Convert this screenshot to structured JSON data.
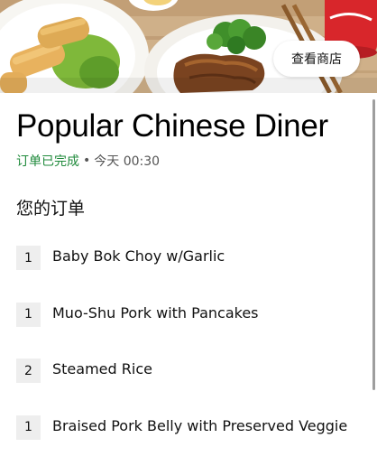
{
  "hero": {
    "image_icon": "food-photo",
    "store_button_label": "查看商店"
  },
  "store": {
    "name": "Popular Chinese Diner",
    "status": "订单已完成",
    "separator": "•",
    "time": "今天 00:30"
  },
  "order": {
    "title": "您的订单",
    "items": [
      {
        "qty": "1",
        "name": "Baby Bok Choy w/Garlic"
      },
      {
        "qty": "1",
        "name": "Muo-Shu Pork with Pancakes"
      },
      {
        "qty": "2",
        "name": "Steamed Rice"
      },
      {
        "qty": "1",
        "name": "Braised Pork Belly with Preserved Veggie"
      }
    ]
  },
  "colors": {
    "status_green": "#1f8a3b",
    "badge_bg": "#eeeeee"
  }
}
